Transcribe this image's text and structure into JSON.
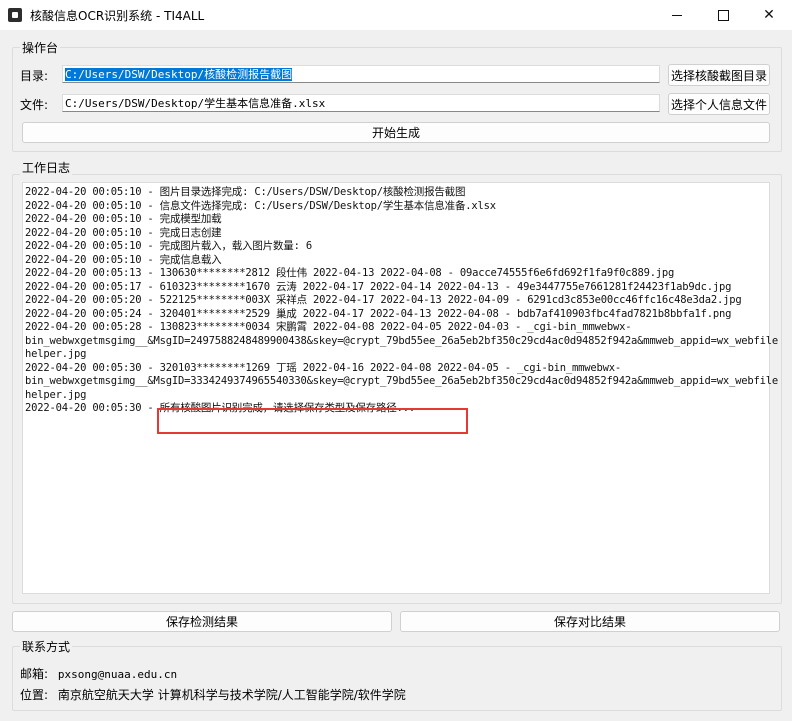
{
  "window": {
    "title": "核酸信息OCR识别系统 - TI4ALL"
  },
  "control_panel": {
    "title": "操作台",
    "dir_label": "目录:",
    "dir_value": "C:/Users/DSW/Desktop/核酸检测报告截图",
    "file_label": "文件:",
    "file_value": "C:/Users/DSW/Desktop/学生基本信息准备.xlsx",
    "select_dir_button": "选择核酸截图目录",
    "select_file_button": "选择个人信息文件",
    "start_button": "开始生成"
  },
  "log": {
    "title": "工作日志",
    "lines": [
      "2022-04-20 00:05:10 - 图片目录选择完成: C:/Users/DSW/Desktop/核酸检测报告截图",
      "2022-04-20 00:05:10 - 信息文件选择完成: C:/Users/DSW/Desktop/学生基本信息准备.xlsx",
      "2022-04-20 00:05:10 - 完成模型加载",
      "2022-04-20 00:05:10 - 完成日志创建",
      "2022-04-20 00:05:10 - 完成图片载入，载入图片数量: 6",
      "2022-04-20 00:05:10 - 完成信息载入",
      "2022-04-20 00:05:13 - 130630********2812 段仕伟 2022-04-13 2022-04-08 - 09acce74555f6e6fd692f1fa9f0c889.jpg",
      "2022-04-20 00:05:17 - 610323********1670 云涛 2022-04-17 2022-04-14 2022-04-13 - 49e3447755e7661281f24423f1ab9dc.jpg",
      "2022-04-20 00:05:20 - 522125********003X 采祥点 2022-04-17 2022-04-13 2022-04-09 - 6291cd3c853e00cc46ffc16c48e3da2.jpg",
      "2022-04-20 00:05:24 - 320401********2529 巢成 2022-04-17 2022-04-13 2022-04-08 - bdb7af410903fbc4fad7821b8bbfa1f.png",
      "2022-04-20 00:05:28 - 130823********0034 宋鹏霄 2022-04-08 2022-04-05 2022-04-03 - _cgi-bin_mmwebwx-",
      "bin_webwxgetmsgimg__&MsgID=2497588248489900438&skey=@crypt_79bd55ee_26a5eb2bf350c29cd4ac0d94852f942a&mmweb_appid=wx_webfile",
      "helper.jpg",
      "2022-04-20 00:05:30 - 320103********1269 丁瑶 2022-04-16 2022-04-08 2022-04-05 - _cgi-bin_mmwebwx-",
      "bin_webwxgetmsgimg__&MsgID=3334249374965540330&skey=@crypt_79bd55ee_26a5eb2bf350c29cd4ac0d94852f942a&mmweb_appid=wx_webfile",
      "helper.jpg",
      "2022-04-20 00:05:30 - 所有核酸图片识别完成，请选择保存类型及保存路径..."
    ]
  },
  "actions": {
    "save_detect": "保存检测结果",
    "save_compare": "保存对比结果"
  },
  "contact": {
    "title": "联系方式",
    "email_label": "邮箱:",
    "email_value": "pxsong@nuaa.edu.cn",
    "location_label": "位置:",
    "location_value": "南京航空航天大学 计算机科学与技术学院/人工智能学院/软件学院"
  },
  "colors": {
    "highlight": "#e53935",
    "selection": "#0078d7"
  }
}
